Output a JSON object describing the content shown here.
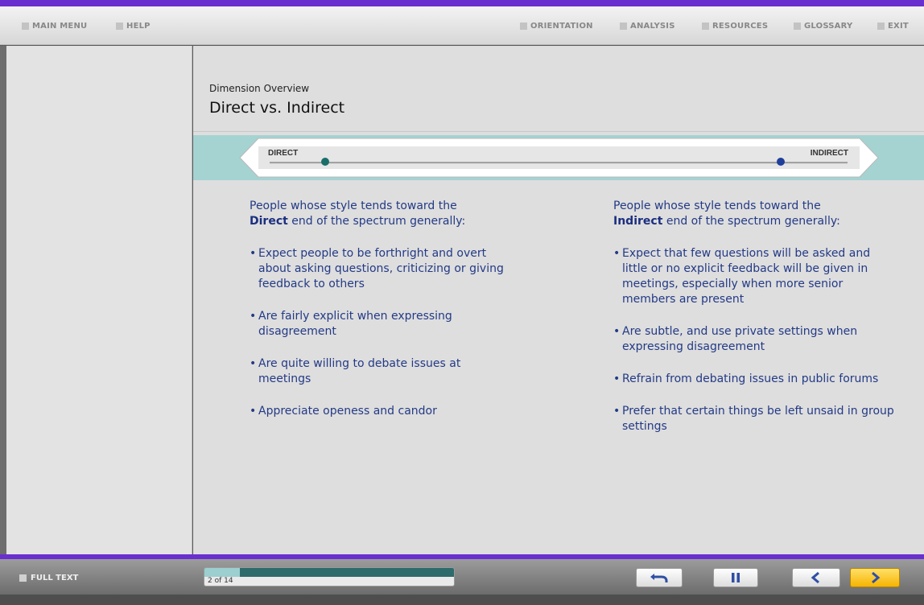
{
  "top_nav": {
    "left": [
      {
        "label": "MAIN MENU"
      },
      {
        "label": "HELP"
      }
    ],
    "right": [
      {
        "label": "ORIENTATION"
      },
      {
        "label": "ANALYSIS"
      },
      {
        "label": "RESOURCES"
      },
      {
        "label": "GLOSSARY"
      },
      {
        "label": "EXIT"
      }
    ]
  },
  "page": {
    "overline": "Dimension Overview",
    "title": "Direct vs. Indirect"
  },
  "scale": {
    "left_label": "DIRECT",
    "right_label": "INDIRECT",
    "left_color": "#1a6e6a",
    "right_color": "#1f3f9b",
    "band_color": "#a4d3d2"
  },
  "direct": {
    "intro_pre": "People whose style tends toward the",
    "intro_term": "Direct",
    "intro_post": "end of the spectrum generally:",
    "bullets": [
      "Expect people to be forthright and overt about asking questions, criticizing or giving feedback to others",
      "Are fairly explicit when expressing disagreement",
      "Are quite willing to debate issues at meetings",
      "Appreciate openess and candor"
    ]
  },
  "indirect": {
    "intro_pre": "People whose style tends toward the",
    "intro_term": "Indirect",
    "intro_post": "end of the spectrum generally:",
    "bullets": [
      "Expect that few questions will be asked and little or no explicit feedback will be given in meetings, especially when more senior members are present",
      "Are subtle, and use private settings when expressing disagreement",
      "Refrain from debating issues in public forums",
      "Prefer that certain things be left unsaid in group settings"
    ]
  },
  "footer": {
    "full_text_label": "FULL TEXT",
    "progress_label": "2 of 14",
    "progress_fraction": 0.143,
    "icons": {
      "replay": "undo-arrow-icon",
      "pause": "pause-icon",
      "back": "chevron-left-icon",
      "next": "chevron-right-icon"
    },
    "accent": "#6a2fcf",
    "next_color": "#f7b400"
  }
}
